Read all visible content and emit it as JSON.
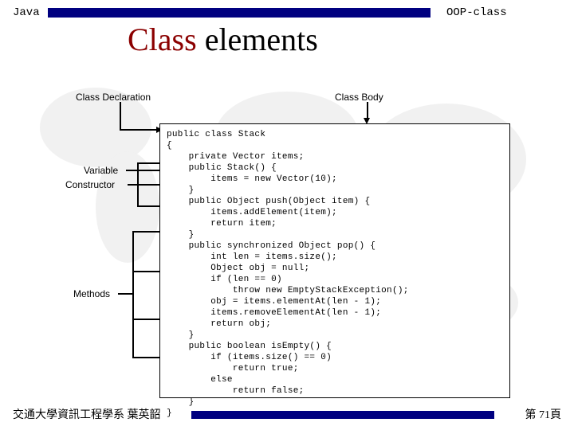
{
  "header": {
    "left_label": "Java",
    "right_label": "OOP-class",
    "title_word1": "Class",
    "title_word2": " elements"
  },
  "labels": {
    "class_declaration": "Class Declaration",
    "class_body": "Class Body",
    "variable": "Variable",
    "constructor": "Constructor",
    "methods": "Methods"
  },
  "code": "public class Stack\n{\n    private Vector items;\n    public Stack() {\n        items = new Vector(10);\n    }\n    public Object push(Object item) {\n        items.addElement(item);\n        return item;\n    }\n    public synchronized Object pop() {\n        int len = items.size();\n        Object obj = null;\n        if (len == 0)\n            throw new EmptyStackException();\n        obj = items.elementAt(len - 1);\n        items.removeElementAt(len - 1);\n        return obj;\n    }\n    public boolean isEmpty() {\n        if (items.size() == 0)\n            return true;\n        else\n            return false;\n    }\n}",
  "footer": {
    "left": "交通大學資訊工程學系 葉英韶",
    "right": "第 71頁"
  }
}
